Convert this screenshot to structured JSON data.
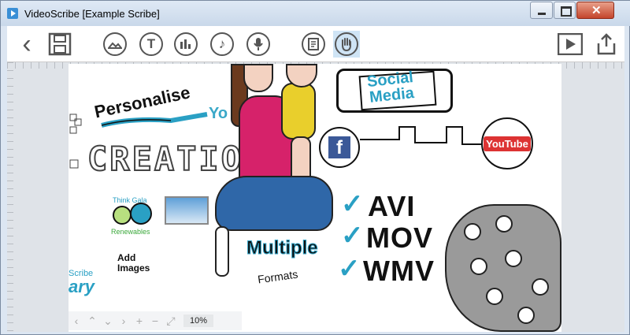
{
  "window": {
    "title": "VideoScribe [Example Scribe]",
    "close_label": "✕"
  },
  "toolbar": {
    "back_icon": "‹",
    "text_tool_label": "T"
  },
  "canvas": {
    "personalise": "Personalise",
    "yo": "Yo",
    "creation": "CREATIO",
    "social_line1": "Social",
    "social_line2": "Media",
    "facebook": "f",
    "youtube": "YouTube",
    "formats": [
      "AVI",
      "MOV",
      "WMV"
    ],
    "multiple": "Multiple",
    "formats_word": "Formats",
    "think": "Think Gala",
    "renewables": "Renewables",
    "add_line1": "Add",
    "add_line2": "Images",
    "scribe": "Scribe",
    "library": "ary"
  },
  "status": {
    "zoom": "10%"
  }
}
